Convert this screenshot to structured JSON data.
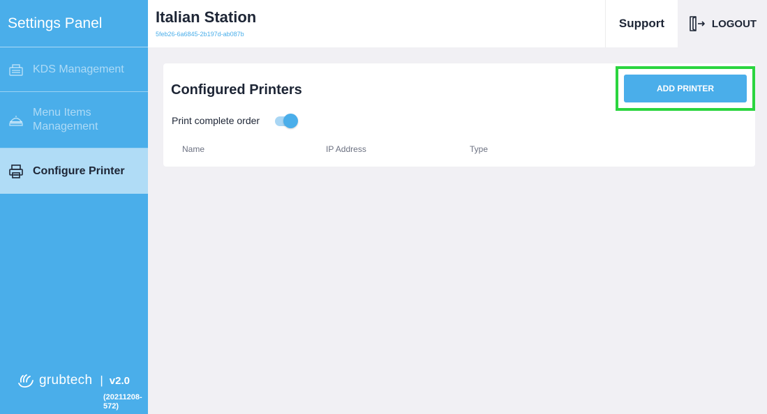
{
  "sidebar": {
    "title": "Settings Panel",
    "items": [
      {
        "label": "KDS Management",
        "icon": "kds-icon",
        "state": "disabled"
      },
      {
        "label": "Menu Items Management",
        "icon": "menu-items-icon",
        "state": "disabled"
      },
      {
        "label": "Configure Printer",
        "icon": "printer-icon",
        "state": "active"
      }
    ],
    "brand": "grubtech",
    "separator": "|",
    "version": "v2.0",
    "build": "(20211208-572)"
  },
  "header": {
    "station_name": "Italian Station",
    "station_id": "5feb26-6a6845-2b197d-ab087b",
    "support_label": "Support",
    "logout_label": "LOGOUT"
  },
  "main": {
    "title": "Configured Printers",
    "add_button_label": "ADD PRINTER",
    "toggle_label": "Print complete order",
    "toggle_on": true,
    "columns": [
      "Name",
      "IP Address",
      "Type"
    ]
  },
  "colors": {
    "accent": "#4aaeea",
    "active_item_bg": "#b0dcf6",
    "highlight": "#2bd53f",
    "text_dark": "#1d2535"
  }
}
